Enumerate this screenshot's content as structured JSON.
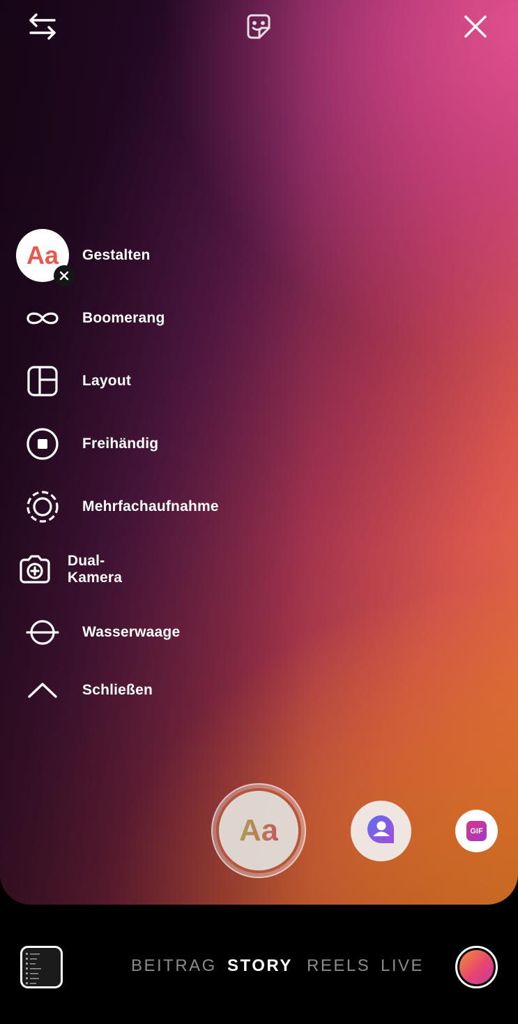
{
  "top_bar": {
    "flip_icon": "flip-camera-icon",
    "sticker_icon": "sticker-icon",
    "close_icon": "close-icon"
  },
  "menu": {
    "items": [
      {
        "label": "Gestalten",
        "icon": "create-aa-icon",
        "icon_text": "Aa"
      },
      {
        "label": "Boomerang",
        "icon": "infinity-icon"
      },
      {
        "label": "Layout",
        "icon": "layout-icon"
      },
      {
        "label": "Freihändig",
        "icon": "handsfree-icon"
      },
      {
        "label": "Mehrfachaufnahme",
        "icon": "multi-capture-icon"
      },
      {
        "label": "Dual-Kamera",
        "icon": "dual-camera-icon"
      },
      {
        "label": "Wasserwaage",
        "icon": "level-icon"
      },
      {
        "label": "Schließen",
        "icon": "chevron-up-icon"
      }
    ]
  },
  "capture": {
    "create_label": "Aa",
    "gif_label": "GIF"
  },
  "modes": {
    "tabs": [
      "BEITRAG",
      "STORY",
      "REELS",
      "LIVE"
    ],
    "active": "STORY"
  },
  "colors": {
    "accent_orange": "#f07a3a",
    "accent_pink": "#e0508f",
    "shutter_ring": "#b7543c"
  }
}
